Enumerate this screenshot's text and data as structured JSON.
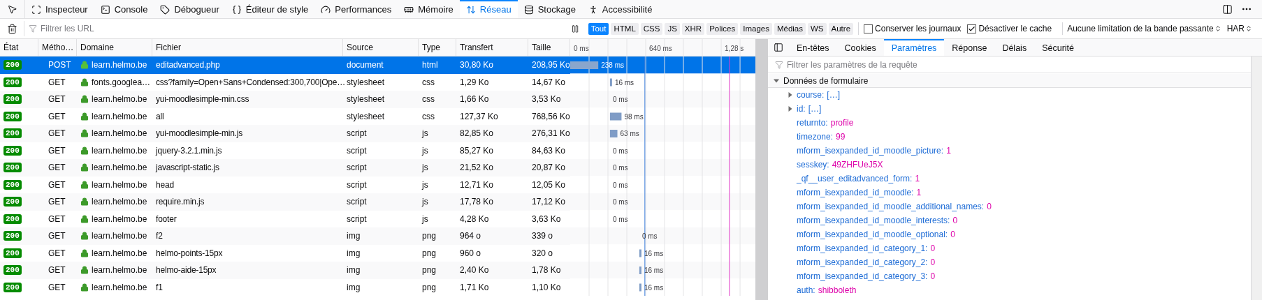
{
  "toolbar": {
    "tabs": [
      {
        "label": "Inspecteur",
        "selected": false
      },
      {
        "label": "Console",
        "selected": false
      },
      {
        "label": "Débogueur",
        "selected": false
      },
      {
        "label": "Éditeur de style",
        "selected": false
      },
      {
        "label": "Performances",
        "selected": false
      },
      {
        "label": "Mémoire",
        "selected": false
      },
      {
        "label": "Réseau",
        "selected": true
      },
      {
        "label": "Stockage",
        "selected": false
      },
      {
        "label": "Accessibilité",
        "selected": false
      }
    ]
  },
  "filter_bar": {
    "placeholder": "Filtrer les URL",
    "type_filters": [
      {
        "label": "Tout",
        "selected": true
      },
      {
        "label": "HTML",
        "selected": false
      },
      {
        "label": "CSS",
        "selected": false
      },
      {
        "label": "JS",
        "selected": false
      },
      {
        "label": "XHR",
        "selected": false
      },
      {
        "label": "Polices",
        "selected": false
      },
      {
        "label": "Images",
        "selected": false
      },
      {
        "label": "Médias",
        "selected": false
      },
      {
        "label": "WS",
        "selected": false
      },
      {
        "label": "Autre",
        "selected": false
      }
    ],
    "checkboxes": [
      {
        "label": "Conserver les journaux",
        "checked": false
      },
      {
        "label": "Désactiver le cache",
        "checked": true
      }
    ],
    "throttling": "Aucune limitation de la bande passante",
    "har": "HAR"
  },
  "table": {
    "columns": [
      "État",
      "Métho…",
      "Domaine",
      "Fichier",
      "Source",
      "Type",
      "Transfert",
      "Taille"
    ],
    "rows": [
      {
        "status": "200",
        "method": "POST",
        "domain": "learn.helmo.be",
        "file": "editadvanced.php",
        "source": "document",
        "type": "html",
        "transfer": "30,80 Ko",
        "size": "208,95 Ko",
        "selected": true
      },
      {
        "status": "200",
        "method": "GET",
        "domain": "fonts.googlea…",
        "file": "css?family=Open+Sans+Condensed:300,700|Ope…",
        "source": "stylesheet",
        "type": "css",
        "transfer": "1,29 Ko",
        "size": "14,67 Ko",
        "selected": false
      },
      {
        "status": "200",
        "method": "GET",
        "domain": "learn.helmo.be",
        "file": "yui-moodlesimple-min.css",
        "source": "stylesheet",
        "type": "css",
        "transfer": "1,66 Ko",
        "size": "3,53 Ko",
        "selected": false
      },
      {
        "status": "200",
        "method": "GET",
        "domain": "learn.helmo.be",
        "file": "all",
        "source": "stylesheet",
        "type": "css",
        "transfer": "127,37 Ko",
        "size": "768,56 Ko",
        "selected": false
      },
      {
        "status": "200",
        "method": "GET",
        "domain": "learn.helmo.be",
        "file": "yui-moodlesimple-min.js",
        "source": "script",
        "type": "js",
        "transfer": "82,85 Ko",
        "size": "276,31 Ko",
        "selected": false
      },
      {
        "status": "200",
        "method": "GET",
        "domain": "learn.helmo.be",
        "file": "jquery-3.2.1.min.js",
        "source": "script",
        "type": "js",
        "transfer": "85,27 Ko",
        "size": "84,63 Ko",
        "selected": false
      },
      {
        "status": "200",
        "method": "GET",
        "domain": "learn.helmo.be",
        "file": "javascript-static.js",
        "source": "script",
        "type": "js",
        "transfer": "21,52 Ko",
        "size": "20,87 Ko",
        "selected": false
      },
      {
        "status": "200",
        "method": "GET",
        "domain": "learn.helmo.be",
        "file": "head",
        "source": "script",
        "type": "js",
        "transfer": "12,71 Ko",
        "size": "12,05 Ko",
        "selected": false
      },
      {
        "status": "200",
        "method": "GET",
        "domain": "learn.helmo.be",
        "file": "require.min.js",
        "source": "script",
        "type": "js",
        "transfer": "17,78 Ko",
        "size": "17,12 Ko",
        "selected": false
      },
      {
        "status": "200",
        "method": "GET",
        "domain": "learn.helmo.be",
        "file": "footer",
        "source": "script",
        "type": "js",
        "transfer": "4,28 Ko",
        "size": "3,63 Ko",
        "selected": false
      },
      {
        "status": "200",
        "method": "GET",
        "domain": "learn.helmo.be",
        "file": "f2",
        "source": "img",
        "type": "png",
        "transfer": "964 o",
        "size": "339 o",
        "selected": false
      },
      {
        "status": "200",
        "method": "GET",
        "domain": "learn.helmo.be",
        "file": "helmo-points-15px",
        "source": "img",
        "type": "png",
        "transfer": "960 o",
        "size": "320 o",
        "selected": false
      },
      {
        "status": "200",
        "method": "GET",
        "domain": "learn.helmo.be",
        "file": "helmo-aide-15px",
        "source": "img",
        "type": "png",
        "transfer": "2,40 Ko",
        "size": "1,78 Ko",
        "selected": false
      },
      {
        "status": "200",
        "method": "GET",
        "domain": "learn.helmo.be",
        "file": "f1",
        "source": "img",
        "type": "png",
        "transfer": "1,71 Ko",
        "size": "1,10 Ko",
        "selected": false
      }
    ],
    "waterfall": {
      "ticks": [
        "0 ms",
        "640 ms",
        "1,28 s"
      ],
      "timings": [
        "238 ms",
        "16 ms",
        "0 ms",
        "98 ms",
        "63 ms",
        "0 ms",
        "0 ms",
        "0 ms",
        "0 ms",
        "0 ms",
        "0 ms",
        "16 ms",
        "16 ms",
        "16 ms"
      ]
    }
  },
  "details": {
    "tabs": [
      {
        "label": "En-têtes",
        "selected": false
      },
      {
        "label": "Cookies",
        "selected": false
      },
      {
        "label": "Paramètres",
        "selected": true
      },
      {
        "label": "Réponse",
        "selected": false
      },
      {
        "label": "Délais",
        "selected": false
      },
      {
        "label": "Sécurité",
        "selected": false
      }
    ],
    "filter_placeholder": "Filtrer les paramètres de la requête",
    "section": {
      "title": "Données de formulaire",
      "expanded": true,
      "params": [
        {
          "kind": "array",
          "key": "course:",
          "value": "[…]"
        },
        {
          "kind": "array",
          "key": "id:",
          "value": "[…]"
        },
        {
          "kind": "value",
          "key": "returnto:",
          "value": "profile"
        },
        {
          "kind": "value",
          "key": "timezone:",
          "value": "99"
        },
        {
          "kind": "value",
          "key": "mform_isexpanded_id_moodle_picture:",
          "value": "1"
        },
        {
          "kind": "value",
          "key": "sesskey:",
          "value": "49ZHFUeJ5X"
        },
        {
          "kind": "value",
          "key": "_qf__user_editadvanced_form:",
          "value": "1"
        },
        {
          "kind": "value",
          "key": "mform_isexpanded_id_moodle:",
          "value": "1"
        },
        {
          "kind": "value",
          "key": "mform_isexpanded_id_moodle_additional_names:",
          "value": "0"
        },
        {
          "kind": "value",
          "key": "mform_isexpanded_id_moodle_interests:",
          "value": "0"
        },
        {
          "kind": "value",
          "key": "mform_isexpanded_id_moodle_optional:",
          "value": "0"
        },
        {
          "kind": "value",
          "key": "mform_isexpanded_id_category_1:",
          "value": "0"
        },
        {
          "kind": "value",
          "key": "mform_isexpanded_id_category_2:",
          "value": "0"
        },
        {
          "kind": "value",
          "key": "mform_isexpanded_id_category_3:",
          "value": "0"
        },
        {
          "kind": "value",
          "key": "auth:",
          "value": "shibboleth"
        }
      ]
    }
  }
}
